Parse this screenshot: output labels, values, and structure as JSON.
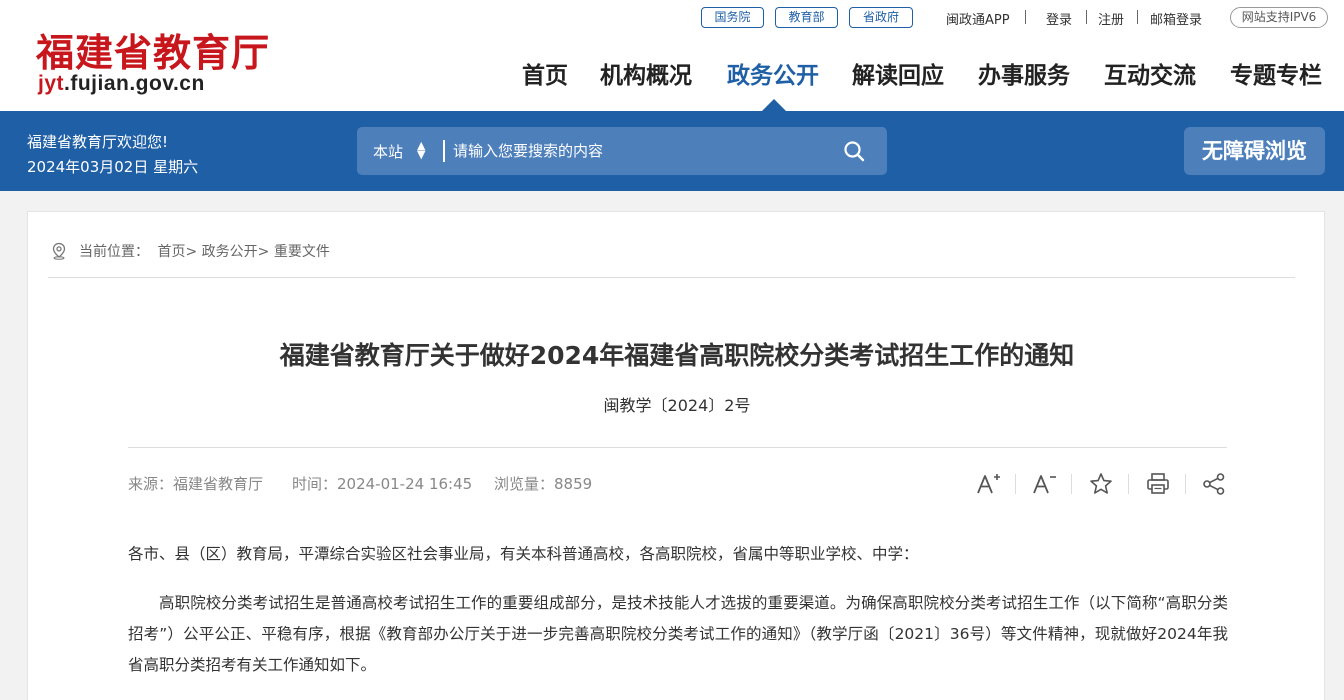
{
  "site": {
    "name_cn": "福建省教育厅",
    "domain_accent": "jyt",
    "domain_rest": ".fujian.gov.cn",
    "brand_red": "#c8161d",
    "brand_blue": "#1f5fa6"
  },
  "top_links": {
    "pills": [
      "国务院",
      "教育部",
      "省政府"
    ],
    "items": [
      "闽政通APP",
      "登录",
      "注册",
      "邮箱登录"
    ],
    "ipv6": "网站支持IPV6"
  },
  "nav": {
    "items": [
      "首页",
      "机构概况",
      "政务公开",
      "解读回应",
      "办事服务",
      "互动交流",
      "专题专栏"
    ],
    "active": "政务公开"
  },
  "bar": {
    "welcome": "福建省教育厅欢迎您!",
    "date": "2024年03月02日 星期六",
    "search_scope": "本站",
    "search_placeholder": "请输入您要搜索的内容",
    "search_icon": "search-icon",
    "accessibility": "无障碍浏览"
  },
  "breadcrumb": {
    "icon": "location-pin-icon",
    "prefix": "当前位置：",
    "items": [
      "首页>",
      "政务公开>",
      "重要文件"
    ]
  },
  "article": {
    "title": "福建省教育厅关于做好2024年福建省高职院校分类考试招生工作的通知",
    "doc_number": "闽教学〔2024〕2号",
    "source": "来源：福建省教育厅",
    "time": "时间：2024-01-24 16:45",
    "views": "浏览量：8859",
    "tools": [
      "font-increase-icon",
      "font-decrease-icon",
      "star-icon",
      "print-icon",
      "share-icon"
    ],
    "paragraphs": [
      "各市、县（区）教育局，平潭综合实验区社会事业局，有关本科普通高校，各高职院校，省属中等职业学校、中学：",
      "高职院校分类考试招生是普通高校考试招生工作的重要组成部分，是技术技能人才选拔的重要渠道。为确保高职院校分类考试招生工作（以下简称“高职分类招考”）公平公正、平稳有序，根据《教育部办公厅关于进一步完善高职院校分类考试工作的通知》（教学厅函〔2021〕36号）等文件精神，现就做好2024年我省高职分类招考有关工作通知如下。"
    ]
  }
}
